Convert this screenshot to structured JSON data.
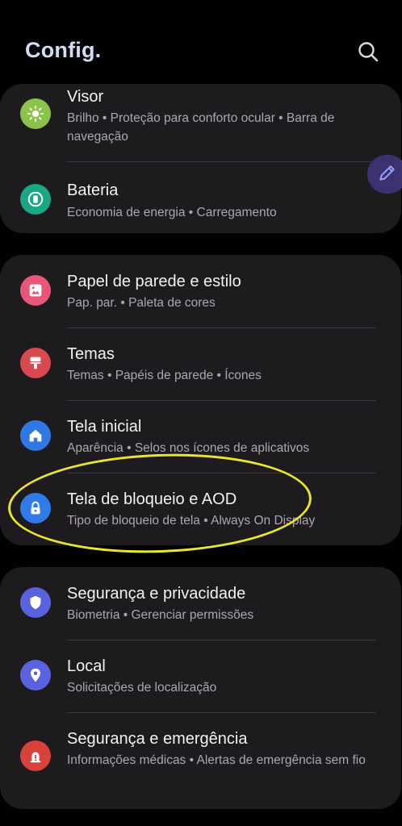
{
  "header": {
    "title": "Config."
  },
  "icons": {
    "search": "search-icon",
    "edit_fab": "pencil-icon"
  },
  "colors": {
    "background": "#010101",
    "card": "#1e1b1f",
    "title": "#d3dcf4",
    "highlight_ring": "#e8e62c",
    "visor": "#8bc34a",
    "bateria": "#1ba783",
    "papel": "#e8567a",
    "temas": "#d84a4f",
    "tela_inicial": "#2e79e6",
    "bloqueio": "#2f7be8",
    "seguranca": "#5a63dc",
    "local": "#5a62e0",
    "emergencia": "#d9423c"
  },
  "groups": [
    {
      "items": [
        {
          "title": "Visor",
          "subtitle": "Brilho  •  Proteção para conforto ocular  •  Barra de navegação",
          "icon": "sun-icon"
        },
        {
          "title": "Bateria",
          "subtitle": "Economia de energia  •  Carregamento",
          "icon": "battery-icon"
        }
      ]
    },
    {
      "items": [
        {
          "title": "Papel de parede e estilo",
          "subtitle": "Pap. par.  •  Paleta de cores",
          "icon": "image-icon"
        },
        {
          "title": "Temas",
          "subtitle": "Temas  •  Papéis de parede  •  Ícones",
          "icon": "brush-icon"
        },
        {
          "title": "Tela inicial",
          "subtitle": "Aparência  •  Selos nos ícones de aplicativos",
          "icon": "home-icon"
        },
        {
          "title": "Tela de bloqueio e AOD",
          "subtitle": "Tipo de bloqueio de tela  •  Always On Display",
          "icon": "lock-icon"
        }
      ]
    },
    {
      "items": [
        {
          "title": "Segurança e privacidade",
          "subtitle": "Biometria  •  Gerenciar permissões",
          "icon": "shield-icon"
        },
        {
          "title": "Local",
          "subtitle": "Solicitações de localização",
          "icon": "location-pin-icon"
        },
        {
          "title": "Segurança e emergência",
          "subtitle": "Informações médicas  •  Alertas de emergência sem fio",
          "icon": "emergency-icon"
        }
      ]
    }
  ]
}
